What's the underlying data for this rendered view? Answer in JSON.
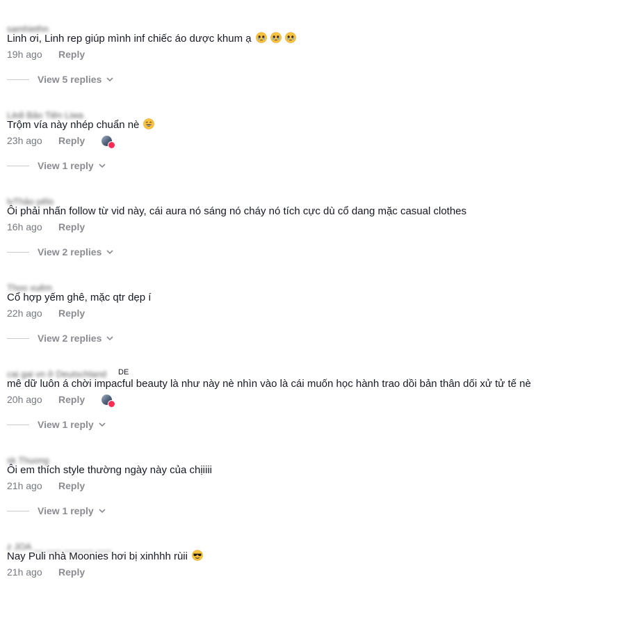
{
  "comments": [
    {
      "username": "samhiethn",
      "text": "Linh ơi, Linh rep giúp mình inf chiếc áo dược khum ạ",
      "emojis": [
        "crying-face",
        "crying-face",
        "crying-face"
      ],
      "time": "19h ago",
      "reply_label": "Reply",
      "view_label": "View 5 replies",
      "creator_liked": false
    },
    {
      "username": "Lèdi Bảo Tiên Liwa",
      "text": "Trộm vía này nhép chuẩn nè",
      "emojis": [
        "grinning-face"
      ],
      "time": "23h ago",
      "reply_label": "Reply",
      "view_label": "View 1 reply",
      "creator_liked": true
    },
    {
      "username": "lvThảo pêlo",
      "text": "Ôi phải nhấn follow từ vid này, cái aura nó sáng nó cháy nó tích cực dù cổ dang mặc casual clothes",
      "emojis": [],
      "time": "16h ago",
      "reply_label": "Reply",
      "view_label": "View 2 replies",
      "creator_liked": false
    },
    {
      "username": "Thoo xuêm",
      "text": "Cổ hợp yếm ghê, mặc qtr dẹp í",
      "emojis": [],
      "time": "22h ago",
      "reply_label": "Reply",
      "view_label": "View 2 replies",
      "creator_liked": false
    },
    {
      "username": "cai gai vn ở Deutschland",
      "username_suffix": "DE",
      "text": "mê dữ luôn á chời impacful beauty là như này nè nhìn vào là cái muốn học hành trao dồi bản thân dối xử tử tế nè",
      "emojis": [],
      "time": "20h ago",
      "reply_label": "Reply",
      "view_label": "View 1 reply",
      "creator_liked": true
    },
    {
      "username": "sk Thuong",
      "text": "Ôi em thích style thường ngày này của chịiiii",
      "emojis": [],
      "time": "21h ago",
      "reply_label": "Reply",
      "view_label": "View 1 reply",
      "creator_liked": false
    },
    {
      "username": "z JOA __ ___ ______ ___",
      "text": "Nay Puli nhà Moonies hơi bị xinhhh rùii",
      "emojis": [
        "sunglasses-face"
      ],
      "time": "21h ago",
      "reply_label": "Reply",
      "view_label": "",
      "creator_liked": false
    }
  ]
}
